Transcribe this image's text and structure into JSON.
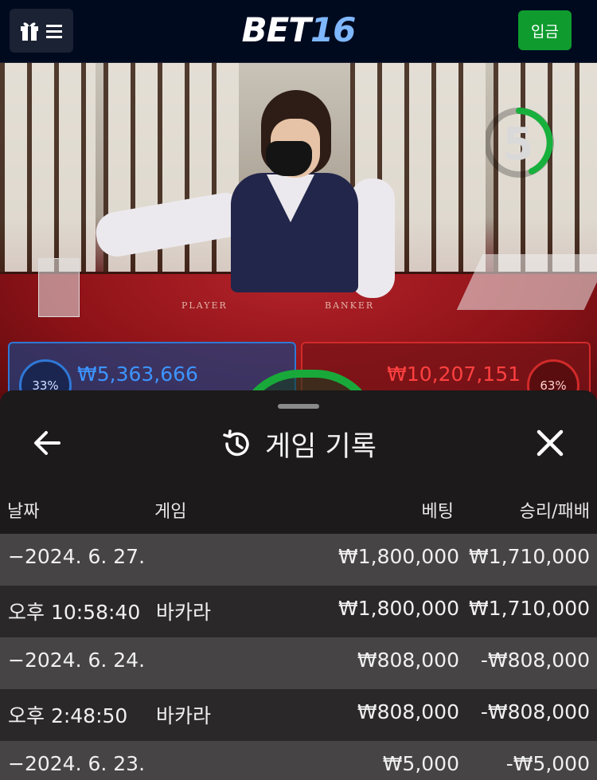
{
  "header": {
    "logo_part1": "BET",
    "logo_part2": "16",
    "deposit_label": "입금",
    "menu_icons": [
      "gift-icon",
      "hamburger-icon"
    ]
  },
  "video": {
    "timer": "5",
    "felt_player": "PLAYER",
    "felt_banker": "BANKER",
    "player_amount": "₩5,363,666",
    "player_pct": "33%",
    "banker_amount": "₩10,207,151",
    "banker_pct": "63%"
  },
  "panel": {
    "title": "게임 기록",
    "columns": {
      "date": "날짜",
      "game": "게임",
      "bet": "베팅",
      "result": "승리/패배"
    },
    "rows": [
      {
        "type": "date",
        "date": "−2024. 6. 27.",
        "game": "",
        "bet": "₩1,800,000",
        "result": "₩1,710,000"
      },
      {
        "type": "detail",
        "date": "오후 10:58:40",
        "game": "바카라",
        "bet": "₩1,800,000",
        "result": "₩1,710,000"
      },
      {
        "type": "date",
        "date": "−2024. 6. 24.",
        "game": "",
        "bet": "₩808,000",
        "result": "-₩808,000"
      },
      {
        "type": "detail",
        "date": "오후 2:48:50",
        "game": "바카라",
        "bet": "₩808,000",
        "result": "-₩808,000"
      },
      {
        "type": "date",
        "date": "−2024. 6. 23.",
        "game": "",
        "bet": "₩5,000",
        "result": "-₩5,000"
      }
    ]
  },
  "colors": {
    "accent_green": "#0f9b2e",
    "player_blue": "#2f78d6",
    "banker_red": "#d12a2a"
  }
}
